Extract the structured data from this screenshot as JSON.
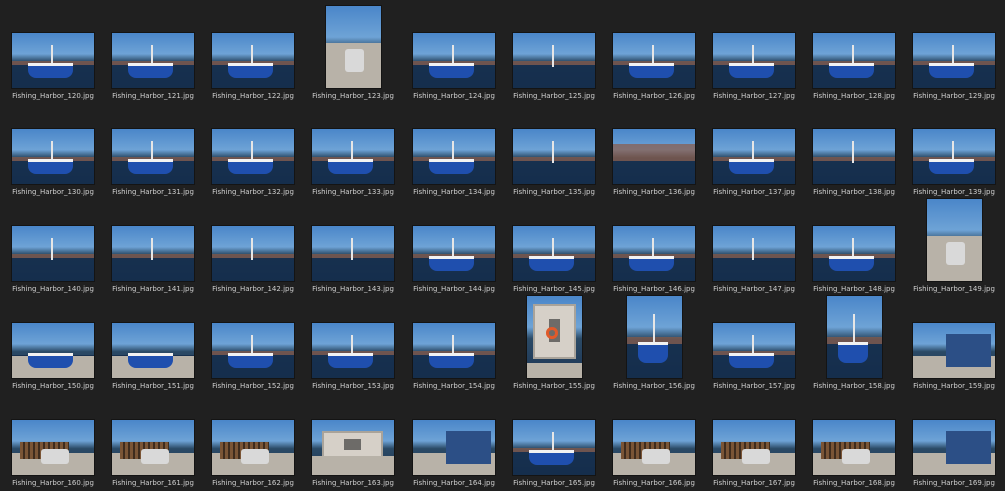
{
  "window": {
    "background": "#202020",
    "label_color": "#cfcfcf"
  },
  "files": [
    {
      "name": "Fishing_Harbor_120.jpg",
      "orientation": "landscape",
      "scene": "boats"
    },
    {
      "name": "Fishing_Harbor_121.jpg",
      "orientation": "landscape",
      "scene": "boats"
    },
    {
      "name": "Fishing_Harbor_122.jpg",
      "orientation": "landscape",
      "scene": "boats"
    },
    {
      "name": "Fishing_Harbor_123.jpg",
      "orientation": "portrait",
      "scene": "utility"
    },
    {
      "name": "Fishing_Harbor_124.jpg",
      "orientation": "landscape",
      "scene": "boats"
    },
    {
      "name": "Fishing_Harbor_125.jpg",
      "orientation": "landscape",
      "scene": "marina"
    },
    {
      "name": "Fishing_Harbor_126.jpg",
      "orientation": "landscape",
      "scene": "boats"
    },
    {
      "name": "Fishing_Harbor_127.jpg",
      "orientation": "landscape",
      "scene": "boats"
    },
    {
      "name": "Fishing_Harbor_128.jpg",
      "orientation": "landscape",
      "scene": "boats"
    },
    {
      "name": "Fishing_Harbor_129.jpg",
      "orientation": "landscape",
      "scene": "boats"
    },
    {
      "name": "Fishing_Harbor_130.jpg",
      "orientation": "landscape",
      "scene": "boats"
    },
    {
      "name": "Fishing_Harbor_131.jpg",
      "orientation": "landscape",
      "scene": "boats"
    },
    {
      "name": "Fishing_Harbor_132.jpg",
      "orientation": "landscape",
      "scene": "boats"
    },
    {
      "name": "Fishing_Harbor_133.jpg",
      "orientation": "landscape",
      "scene": "boats"
    },
    {
      "name": "Fishing_Harbor_134.jpg",
      "orientation": "landscape",
      "scene": "boats"
    },
    {
      "name": "Fishing_Harbor_135.jpg",
      "orientation": "landscape",
      "scene": "marina"
    },
    {
      "name": "Fishing_Harbor_136.jpg",
      "orientation": "landscape",
      "scene": "rocks"
    },
    {
      "name": "Fishing_Harbor_137.jpg",
      "orientation": "landscape",
      "scene": "boats"
    },
    {
      "name": "Fishing_Harbor_138.jpg",
      "orientation": "landscape",
      "scene": "marina"
    },
    {
      "name": "Fishing_Harbor_139.jpg",
      "orientation": "landscape",
      "scene": "boats"
    },
    {
      "name": "Fishing_Harbor_140.jpg",
      "orientation": "landscape",
      "scene": "marina"
    },
    {
      "name": "Fishing_Harbor_141.jpg",
      "orientation": "landscape",
      "scene": "marina"
    },
    {
      "name": "Fishing_Harbor_142.jpg",
      "orientation": "landscape",
      "scene": "marina"
    },
    {
      "name": "Fishing_Harbor_143.jpg",
      "orientation": "landscape",
      "scene": "marina"
    },
    {
      "name": "Fishing_Harbor_144.jpg",
      "orientation": "landscape",
      "scene": "boats"
    },
    {
      "name": "Fishing_Harbor_145.jpg",
      "orientation": "landscape",
      "scene": "boats"
    },
    {
      "name": "Fishing_Harbor_146.jpg",
      "orientation": "landscape",
      "scene": "boats"
    },
    {
      "name": "Fishing_Harbor_147.jpg",
      "orientation": "landscape",
      "scene": "marina"
    },
    {
      "name": "Fishing_Harbor_148.jpg",
      "orientation": "landscape",
      "scene": "boats"
    },
    {
      "name": "Fishing_Harbor_149.jpg",
      "orientation": "portrait",
      "scene": "utility"
    },
    {
      "name": "Fishing_Harbor_150.jpg",
      "orientation": "landscape",
      "scene": "dock"
    },
    {
      "name": "Fishing_Harbor_151.jpg",
      "orientation": "landscape",
      "scene": "dock"
    },
    {
      "name": "Fishing_Harbor_152.jpg",
      "orientation": "landscape",
      "scene": "boats"
    },
    {
      "name": "Fishing_Harbor_153.jpg",
      "orientation": "landscape",
      "scene": "boats"
    },
    {
      "name": "Fishing_Harbor_154.jpg",
      "orientation": "landscape",
      "scene": "boats"
    },
    {
      "name": "Fishing_Harbor_155.jpg",
      "orientation": "portrait",
      "scene": "lifebuoy"
    },
    {
      "name": "Fishing_Harbor_156.jpg",
      "orientation": "portrait",
      "scene": "boats"
    },
    {
      "name": "Fishing_Harbor_157.jpg",
      "orientation": "landscape",
      "scene": "boats"
    },
    {
      "name": "Fishing_Harbor_158.jpg",
      "orientation": "portrait",
      "scene": "boats"
    },
    {
      "name": "Fishing_Harbor_159.jpg",
      "orientation": "landscape",
      "scene": "container"
    },
    {
      "name": "Fishing_Harbor_160.jpg",
      "orientation": "landscape",
      "scene": "traps"
    },
    {
      "name": "Fishing_Harbor_161.jpg",
      "orientation": "landscape",
      "scene": "traps"
    },
    {
      "name": "Fishing_Harbor_162.jpg",
      "orientation": "landscape",
      "scene": "traps"
    },
    {
      "name": "Fishing_Harbor_163.jpg",
      "orientation": "landscape",
      "scene": "building"
    },
    {
      "name": "Fishing_Harbor_164.jpg",
      "orientation": "landscape",
      "scene": "container"
    },
    {
      "name": "Fishing_Harbor_165.jpg",
      "orientation": "landscape",
      "scene": "boats"
    },
    {
      "name": "Fishing_Harbor_166.jpg",
      "orientation": "landscape",
      "scene": "traps"
    },
    {
      "name": "Fishing_Harbor_167.jpg",
      "orientation": "landscape",
      "scene": "traps"
    },
    {
      "name": "Fishing_Harbor_168.jpg",
      "orientation": "landscape",
      "scene": "traps"
    },
    {
      "name": "Fishing_Harbor_169.jpg",
      "orientation": "landscape",
      "scene": "container"
    }
  ]
}
